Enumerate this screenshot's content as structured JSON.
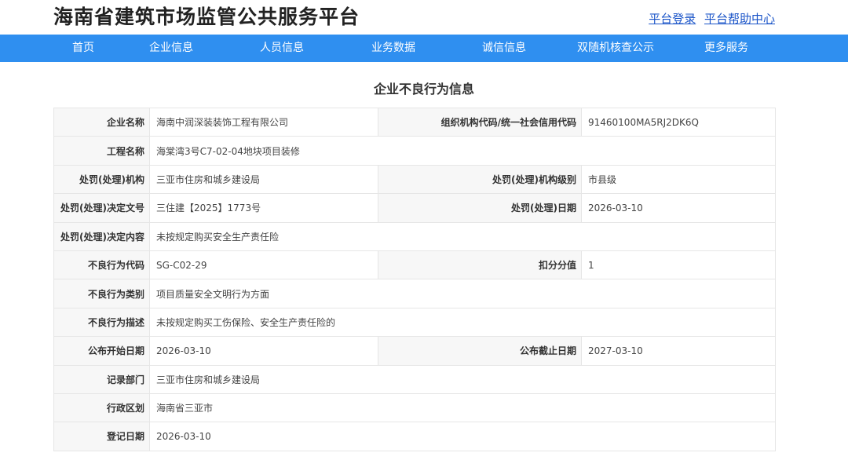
{
  "header": {
    "title": "海南省建筑市场监管公共服务平台",
    "login": "平台登录",
    "help": "平台帮助中心"
  },
  "nav": [
    "首页",
    "企业信息",
    "人员信息",
    "业务数据",
    "诚信信息",
    "双随机核查公示",
    "更多服务"
  ],
  "page_title": "企业不良行为信息",
  "rows": [
    {
      "l1": "企业名称",
      "v1": "海南中润深装装饰工程有限公司",
      "l2": "组织机构代码/统一社会信用代码",
      "v2": "91460100MA5RJ2DK6Q"
    },
    {
      "l1": "工程名称",
      "v1": "海棠湾3号C7-02-04地块项目装修"
    },
    {
      "l1": "处罚(处理)机构",
      "v1": "三亚市住房和城乡建设局",
      "l2": "处罚(处理)机构级别",
      "v2": "市县级"
    },
    {
      "l1": "处罚(处理)决定文号",
      "v1": "三住建【2025】1773号",
      "l2": "处罚(处理)日期",
      "v2": "2026-03-10"
    },
    {
      "l1": "处罚(处理)决定内容",
      "v1": "未按规定购买安全生产责任险"
    },
    {
      "l1": "不良行为代码",
      "v1": "SG-C02-29",
      "l2": "扣分分值",
      "v2": "1"
    },
    {
      "l1": "不良行为类别",
      "v1": "项目质量安全文明行为方面"
    },
    {
      "l1": "不良行为描述",
      "v1": "未按规定购买工伤保险、安全生产责任险的"
    },
    {
      "l1": "公布开始日期",
      "v1": "2026-03-10",
      "l2": "公布截止日期",
      "v2": "2027-03-10"
    },
    {
      "l1": "记录部门",
      "v1": "三亚市住房和城乡建设局"
    },
    {
      "l1": "行政区划",
      "v1": "海南省三亚市"
    },
    {
      "l1": "登记日期",
      "v1": "2026-03-10"
    }
  ],
  "colors": {
    "nav_bg": "#2f8ff0",
    "link": "#1a54c8",
    "label_bg": "#f7f7f7",
    "border": "#e6e6e6"
  }
}
